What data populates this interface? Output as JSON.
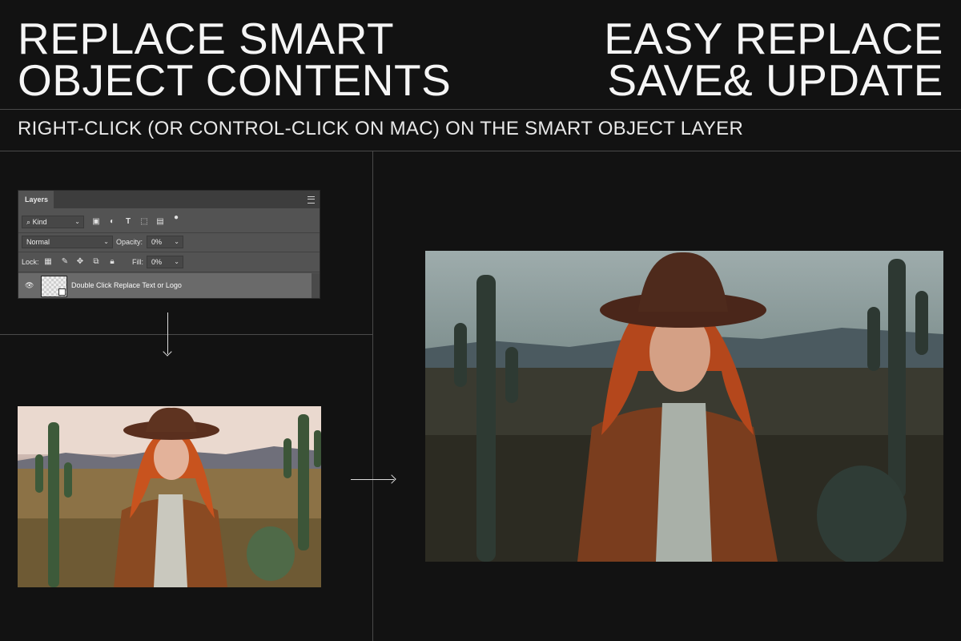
{
  "headline_left": {
    "line1": "REPLACE SMART",
    "line2": "OBJECT CONTENTS"
  },
  "headline_right": {
    "line1": "EASY REPLACE",
    "line2": "SAVE& UPDATE"
  },
  "subtitle": "RIGHT-CLICK (OR CONTROL-CLICK ON MAC) ON THE SMART OBJECT LAYER",
  "layers_panel": {
    "tab": "Layers",
    "filter": "Kind",
    "blend_mode": "Normal",
    "opacity_label": "Opacity:",
    "opacity_value": "0%",
    "lock_label": "Lock:",
    "fill_label": "Fill:",
    "fill_value": "0%",
    "layer_name": "Double Click Replace Text or Logo"
  },
  "colors": {
    "background": "#121212",
    "divider": "#4a4a4a",
    "text": "#f2f2f2",
    "panel": "#535353"
  }
}
